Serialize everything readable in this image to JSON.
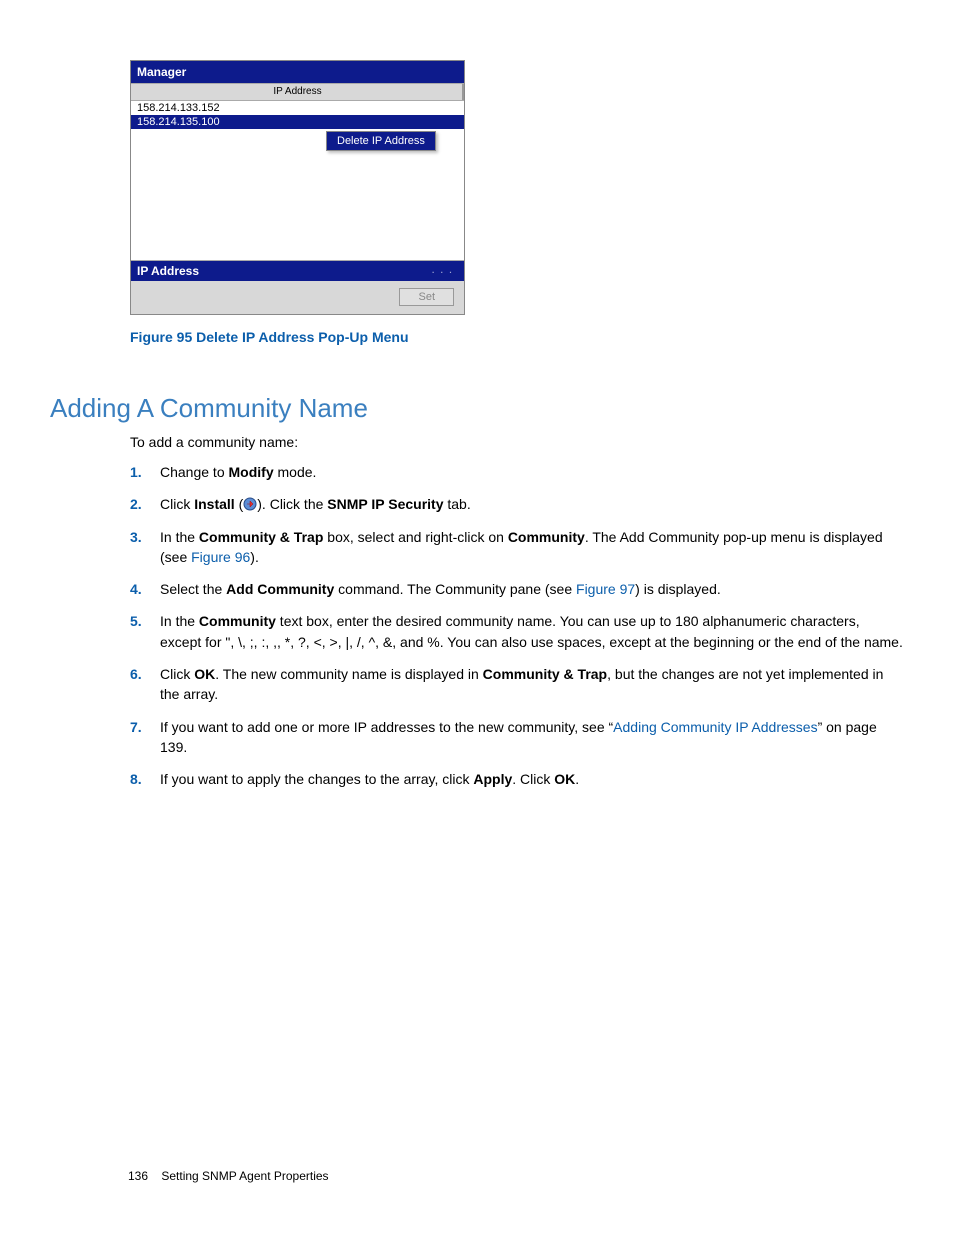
{
  "figure": {
    "header": "Manager",
    "column_header": "IP Address",
    "rows": [
      "158.214.133.152",
      "158.214.135.100"
    ],
    "context_menu_item": "Delete IP Address",
    "footer_label": "IP Address",
    "set_button": "Set",
    "caption": "Figure 95 Delete IP Address Pop-Up Menu"
  },
  "section_heading": "Adding A Community Name",
  "intro": "To add a community name:",
  "steps": {
    "s1": {
      "num": "1.",
      "a": "Change to ",
      "b": "Modify",
      "c": " mode."
    },
    "s2": {
      "num": "2.",
      "a": "Click ",
      "b": "Install",
      "c": " (",
      "d": ").  Click the ",
      "e": "SNMP IP Security",
      "f": " tab."
    },
    "s3": {
      "num": "3.",
      "a": "In the ",
      "b": "Community & Trap",
      "c": " box, select and right-click on ",
      "d": "Community",
      "e": ".  The Add Community pop-up menu is displayed (see ",
      "link": "Figure 96",
      "f": ")."
    },
    "s4": {
      "num": "4.",
      "a": "Select the ",
      "b": "Add Community",
      "c": " command.  The Community pane (see ",
      "link": "Figure 97",
      "d": ") is displayed."
    },
    "s5": {
      "num": "5.",
      "a": "In the ",
      "b": "Community",
      "c": " text box, enter the desired community name.  You can use up to 180 alphanumeric characters, except for \", \\, ;, :, ,, *, ?, <, >, |, /, ^, &, and %.  You can also use spaces, except at the beginning or the end of the name."
    },
    "s6": {
      "num": "6.",
      "a": "Click ",
      "b": "OK",
      "c": ". The new community name is displayed in ",
      "d": "Community & Trap",
      "e": ", but the changes are not yet implemented in the array."
    },
    "s7": {
      "num": "7.",
      "a": "If you want to add one or more IP addresses to the new community, see “",
      "link": "Adding Community IP Addresses",
      "b": "” on page 139."
    },
    "s8": {
      "num": "8.",
      "a": "If you want to apply the changes to the array, click ",
      "b": "Apply",
      "c": ".  Click ",
      "d": "OK",
      "e": "."
    }
  },
  "footer": {
    "page": "136",
    "title": "Setting SNMP Agent Properties"
  }
}
